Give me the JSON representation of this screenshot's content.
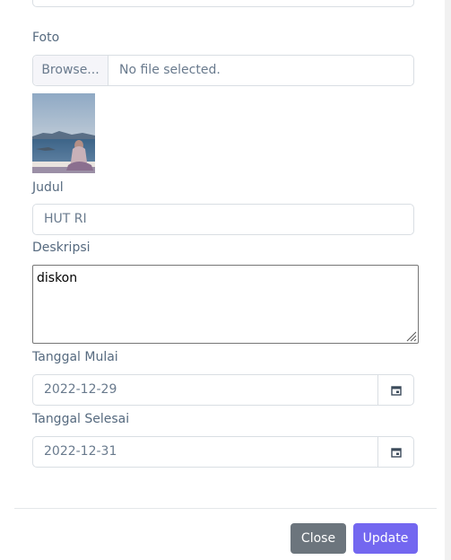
{
  "form": {
    "foto_label": "Foto",
    "file_button_label": "Browse...",
    "file_status": "No file selected.",
    "judul_label": "Judul",
    "judul_value": "HUT RI",
    "deskripsi_label": "Deskripsi",
    "deskripsi_value": "diskon",
    "tanggal_mulai_label": "Tanggal Mulai",
    "tanggal_mulai_value": "2022-12-29",
    "tanggal_selesai_label": "Tanggal Selesai",
    "tanggal_selesai_value": "2022-12-31"
  },
  "footer": {
    "close_label": "Close",
    "update_label": "Update"
  },
  "colors": {
    "primary": "#7367f0",
    "secondary": "#6c757d"
  },
  "icons": {
    "calendar": "calendar-icon",
    "resize": "resize-grip-icon"
  }
}
